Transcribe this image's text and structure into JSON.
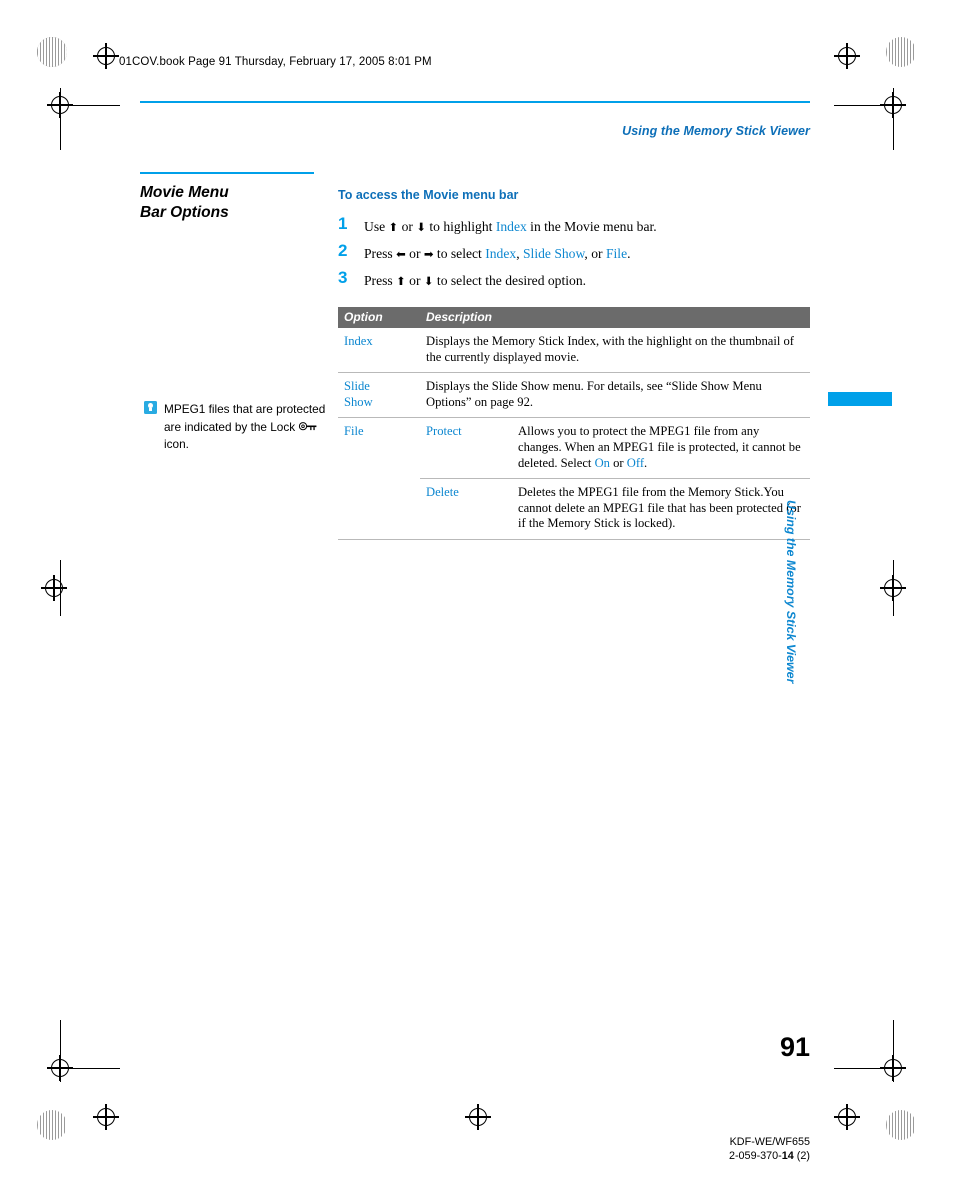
{
  "header": {
    "file_line": "01COV.book  Page 91  Thursday, February 17, 2005  8:01 PM",
    "running_head": "Using the Memory Stick Viewer"
  },
  "left_column": {
    "section_title_line1": "Movie Menu",
    "section_title_line2": "Bar Options",
    "note": "MPEG1 files that are protected are indicated by the Lock     icon.",
    "note_icon": "tip-bulb-icon",
    "lock_icon": "lock-icon"
  },
  "main": {
    "sub_head": "To access the Movie menu bar",
    "steps": [
      {
        "number": "1",
        "parts": [
          {
            "t": "Use ",
            "c": "black"
          },
          {
            "t": "↑",
            "c": "arrow"
          },
          {
            "t": " or ",
            "c": "black"
          },
          {
            "t": "↓",
            "c": "arrow"
          },
          {
            "t": " to highlight ",
            "c": "black"
          },
          {
            "t": "Index",
            "c": "blue"
          },
          {
            "t": " in the Movie menu bar.",
            "c": "black"
          }
        ]
      },
      {
        "number": "2",
        "parts": [
          {
            "t": "Press ",
            "c": "black"
          },
          {
            "t": "←",
            "c": "arrow"
          },
          {
            "t": " or ",
            "c": "black"
          },
          {
            "t": "→",
            "c": "arrow"
          },
          {
            "t": " to select ",
            "c": "black"
          },
          {
            "t": "Index",
            "c": "blue"
          },
          {
            "t": ", ",
            "c": "black"
          },
          {
            "t": "Slide Show",
            "c": "blue"
          },
          {
            "t": ", or ",
            "c": "black"
          },
          {
            "t": "File",
            "c": "blue"
          },
          {
            "t": ".",
            "c": "black"
          }
        ]
      },
      {
        "number": "3",
        "parts": [
          {
            "t": "Press ",
            "c": "black"
          },
          {
            "t": "↑",
            "c": "arrow"
          },
          {
            "t": " or ",
            "c": "black"
          },
          {
            "t": "↓",
            "c": "arrow"
          },
          {
            "t": " to select the desired option.",
            "c": "black"
          }
        ]
      }
    ],
    "table": {
      "columns": [
        "Option",
        "Description"
      ],
      "rows": [
        {
          "option": "Index",
          "sub": "",
          "description": "Displays the Memory Stick Index, with the highlight on the thumbnail of the currently displayed movie."
        },
        {
          "option": "Slide Show",
          "sub": "",
          "description": "Displays the Slide Show menu. For details, see “Slide Show Menu Options” on page 92."
        },
        {
          "option": "File",
          "sub": "Protect",
          "description_parts": [
            {
              "t": "Allows you to protect the MPEG1 file from any changes. When an MPEG1 file is protected, it cannot be deleted. Select ",
              "c": "black"
            },
            {
              "t": "On",
              "c": "blue"
            },
            {
              "t": " or ",
              "c": "black"
            },
            {
              "t": "Off",
              "c": "blue"
            },
            {
              "t": ".",
              "c": "black"
            }
          ]
        },
        {
          "option": "",
          "sub": "Delete",
          "description": "Deletes the MPEG1 file from the Memory Stick.You cannot delete an MPEG1 file that has been protected (or if the Memory Stick is locked)."
        }
      ]
    }
  },
  "side_tab": {
    "label": "Using the Memory Stick Viewer",
    "accent_color": "#00a0e9"
  },
  "footer": {
    "page_number": "91",
    "model": "KDF-WE/WF655",
    "doc_number_prefix": "2-059-370-",
    "doc_number_bold": "14",
    "doc_number_suffix": " (2)"
  },
  "colors": {
    "accent_blue": "#00a0e9",
    "link_blue": "#0d87d0",
    "head_blue": "#0d6fb8",
    "table_header_bg": "#6b6b6b"
  }
}
